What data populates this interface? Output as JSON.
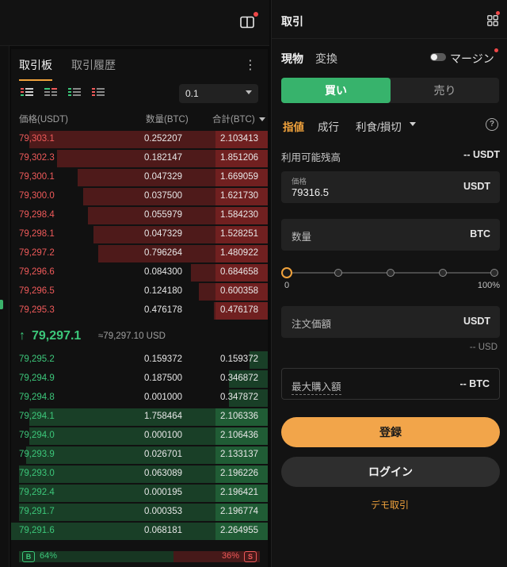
{
  "colors": {
    "accent": "#f0a23c",
    "ask": "#f05a5a",
    "bid": "#3cc77a",
    "buy_button": "#37b36c",
    "register_button": "#f2a54a"
  },
  "orderbook": {
    "tabs": [
      "取引板",
      "取引履歴"
    ],
    "more_icon": "more-vertical-icon",
    "precision": "0.1",
    "headers": {
      "price": "価格(USDT)",
      "amount": "数量(BTC)",
      "total": "合計(BTC)"
    },
    "asks": [
      {
        "price": "79,303.1",
        "amount": "0.252207",
        "total": "2.103413",
        "depth": 0.93
      },
      {
        "price": "79,302.3",
        "amount": "0.182147",
        "total": "1.851206",
        "depth": 0.82
      },
      {
        "price": "79,300.1",
        "amount": "0.047329",
        "total": "1.669059",
        "depth": 0.74
      },
      {
        "price": "79,300.0",
        "amount": "0.037500",
        "total": "1.621730",
        "depth": 0.72
      },
      {
        "price": "79,298.4",
        "amount": "0.055979",
        "total": "1.584230",
        "depth": 0.7
      },
      {
        "price": "79,298.1",
        "amount": "0.047329",
        "total": "1.528251",
        "depth": 0.68
      },
      {
        "price": "79,297.2",
        "amount": "0.796264",
        "total": "1.480922",
        "depth": 0.66
      },
      {
        "price": "79,296.6",
        "amount": "0.084300",
        "total": "0.684658",
        "depth": 0.3
      },
      {
        "price": "79,296.5",
        "amount": "0.124180",
        "total": "0.600358",
        "depth": 0.27
      },
      {
        "price": "79,295.3",
        "amount": "0.476178",
        "total": "0.476178",
        "depth": 0.21
      }
    ],
    "mid": {
      "arrow": "↑",
      "price": "79,297.1",
      "usd": "≈79,297.10 USD"
    },
    "bids": [
      {
        "price": "79,295.2",
        "amount": "0.159372",
        "total": "0.159372",
        "depth": 0.07
      },
      {
        "price": "79,294.9",
        "amount": "0.187500",
        "total": "0.346872",
        "depth": 0.15
      },
      {
        "price": "79,294.8",
        "amount": "0.001000",
        "total": "0.347872",
        "depth": 0.15
      },
      {
        "price": "79,294.1",
        "amount": "1.758464",
        "total": "2.106336",
        "depth": 0.93
      },
      {
        "price": "79,294.0",
        "amount": "0.000100",
        "total": "2.106436",
        "depth": 0.93
      },
      {
        "price": "79,293.9",
        "amount": "0.026701",
        "total": "2.133137",
        "depth": 0.94
      },
      {
        "price": "79,293.0",
        "amount": "0.063089",
        "total": "2.196226",
        "depth": 0.97
      },
      {
        "price": "79,292.4",
        "amount": "0.000195",
        "total": "2.196421",
        "depth": 0.97
      },
      {
        "price": "79,291.7",
        "amount": "0.000353",
        "total": "2.196774",
        "depth": 0.97
      },
      {
        "price": "79,291.6",
        "amount": "0.068181",
        "total": "2.264955",
        "depth": 1.0
      }
    ],
    "ratio": {
      "buy_badge": "B",
      "buy_pct": "64%",
      "buy_value": 0.64,
      "sell_badge": "S",
      "sell_pct": "36%",
      "sell_value": 0.36
    }
  },
  "trade": {
    "title": "取引",
    "mode_tabs": {
      "spot": "現物",
      "convert": "変換"
    },
    "margin_label": "マージン",
    "side": {
      "buy": "買い",
      "sell": "売り"
    },
    "order_types": {
      "limit": "指値",
      "market": "成行",
      "tpsl": "利食/損切"
    },
    "available": {
      "label": "利用可能残高",
      "value": "-- USDT"
    },
    "price_field": {
      "label": "価格",
      "value": "79316.5",
      "unit": "USDT"
    },
    "qty_field": {
      "label": "数量",
      "unit": "BTC"
    },
    "slider": {
      "min_label": "0",
      "max_label": "100%",
      "value": 0
    },
    "order_value": {
      "label": "注文価額",
      "unit": "USDT",
      "sub": "-- USD"
    },
    "max_buy": {
      "label": "最大購入額",
      "value": "-- BTC"
    },
    "register": "登録",
    "login": "ログイン",
    "demo": "デモ取引"
  }
}
